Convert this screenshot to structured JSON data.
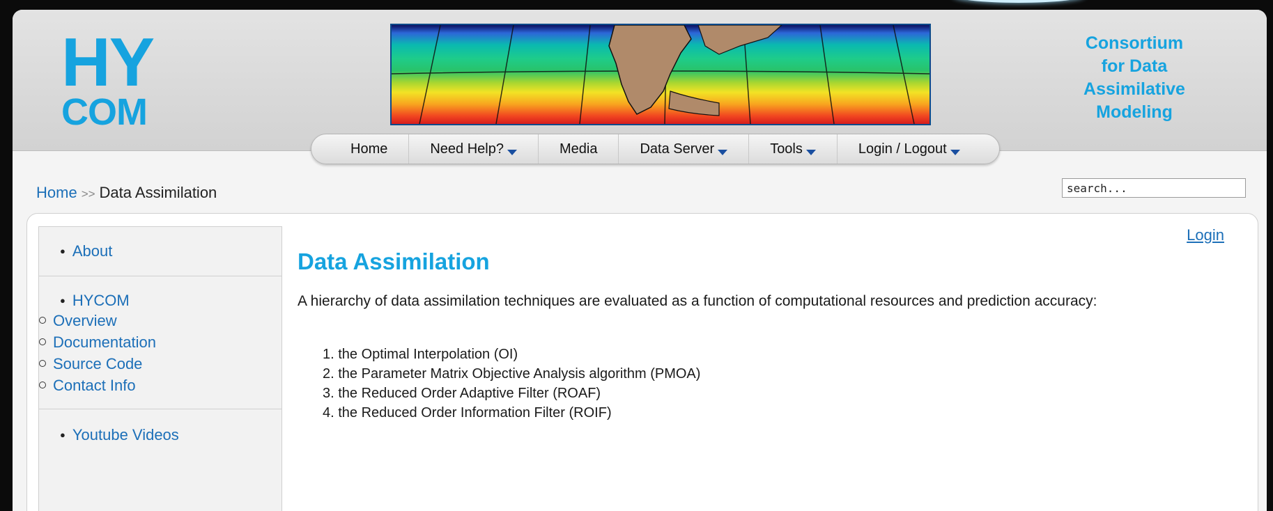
{
  "logo": {
    "line1": "HY",
    "line2": "COM"
  },
  "consortium": [
    "Consortium",
    "for Data",
    "Assimilative",
    "Modeling"
  ],
  "nav": {
    "items": [
      {
        "label": "Home",
        "dropdown": false
      },
      {
        "label": "Need Help?",
        "dropdown": true
      },
      {
        "label": "Media",
        "dropdown": false
      },
      {
        "label": "Data Server",
        "dropdown": true
      },
      {
        "label": "Tools",
        "dropdown": true
      },
      {
        "label": "Login / Logout",
        "dropdown": true
      }
    ]
  },
  "breadcrumb": {
    "home": "Home",
    "separator": ">>",
    "current": "Data Assimilation"
  },
  "search": {
    "value": "search..."
  },
  "sidebar": {
    "about": "About",
    "hycom": "HYCOM",
    "hycom_items": [
      "Overview",
      "Documentation",
      "Source Code",
      "Contact Info"
    ],
    "youtube": "Youtube Videos"
  },
  "main": {
    "login": "Login",
    "title": "Data Assimilation",
    "intro": "A hierarchy of data assimilation techniques are evaluated as a function of computational resources and prediction accuracy:",
    "list": [
      "the Optimal Interpolation (OI)",
      "the Parameter Matrix Objective Analysis algorithm (PMOA)",
      "the Reduced Order Adaptive Filter (ROAF)",
      "the Reduced Order Information Filter (ROIF)"
    ]
  },
  "colors": {
    "brand_blue": "#16a3df",
    "link_blue": "#1c6fb8",
    "nav_caret": "#1a4fa0"
  }
}
